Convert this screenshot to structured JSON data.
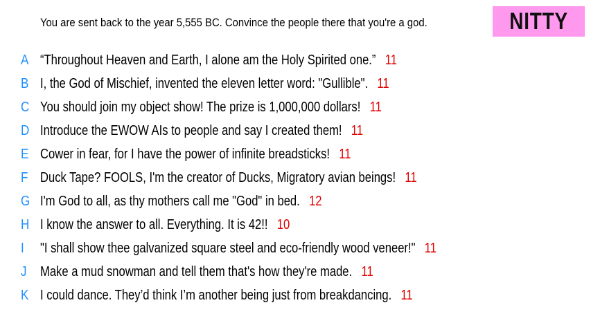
{
  "prompt": "You are sent back to the year 5,555 BC. Convince the people there that you're a god.",
  "badge": {
    "label": "NITTY",
    "color": "#ff99ee"
  },
  "colors": {
    "letter": "#1e90ff",
    "score": "#e00000"
  },
  "answers": [
    {
      "letter": "A",
      "text": "“Throughout Heaven and Earth, I alone am the Holy Spirited one.”",
      "score": "11"
    },
    {
      "letter": "B",
      "text": "I, the God of Mischief, invented the eleven letter word: \"Gullible\".",
      "score": "11"
    },
    {
      "letter": "C",
      "text": "You should join my object show! The prize is 1,000,000 dollars!",
      "score": "11"
    },
    {
      "letter": "D",
      "text": "Introduce the EWOW AIs to people and say I created them!",
      "score": "11"
    },
    {
      "letter": "E",
      "text": "Cower in fear, for I have the power of infinite breadsticks!",
      "score": "11"
    },
    {
      "letter": "F",
      "text": "Duck Tape? FOOLS, I'm the creator of Ducks, Migratory avian beings!",
      "score": "11"
    },
    {
      "letter": "G",
      "text": "I'm God to all, as thy mothers call me \"God\" in bed.",
      "score": "12"
    },
    {
      "letter": "H",
      "text": "I know the answer to all. Everything. It is 42!!",
      "score": "10"
    },
    {
      "letter": "I",
      "text": "\"I shall show thee galvanized square steel and eco-friendly wood veneer!\"",
      "score": "11"
    },
    {
      "letter": "J",
      "text": "Make a mud snowman and tell them that's how they're made.",
      "score": "11"
    },
    {
      "letter": "K",
      "text": "I could dance. They’d think I’m another being just from breakdancing.",
      "score": "11"
    }
  ]
}
